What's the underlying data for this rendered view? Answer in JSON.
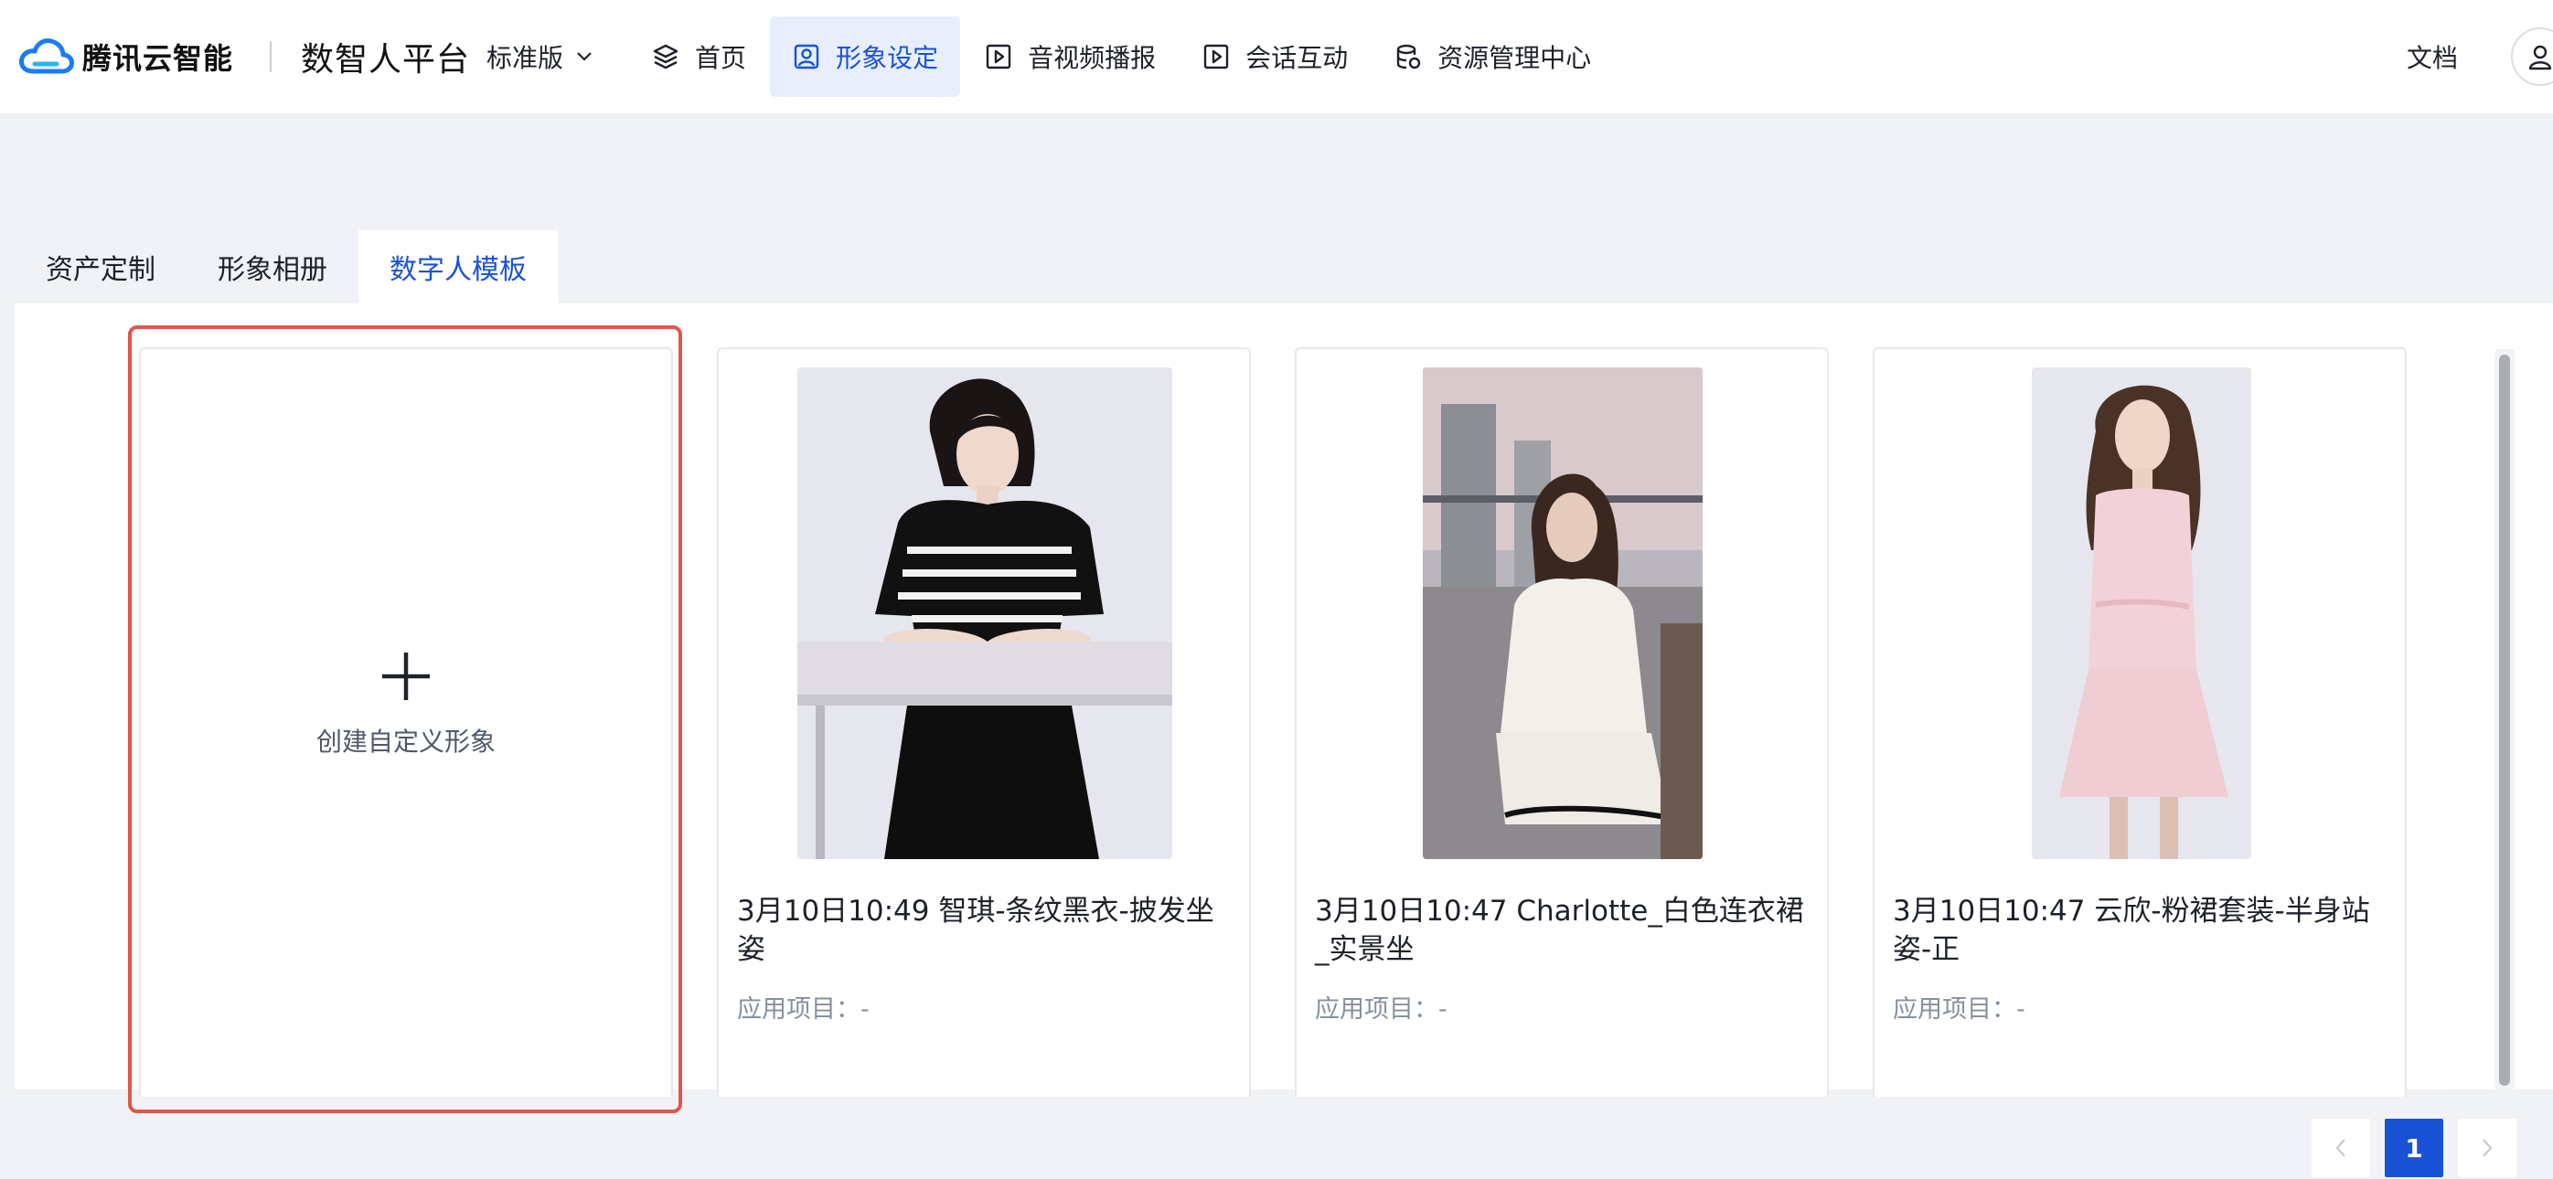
{
  "header": {
    "brand_name": "腾讯云智能",
    "platform_name": "数智人平台",
    "edition": "标准版",
    "nav": [
      {
        "label": "首页",
        "icon": "layers-icon"
      },
      {
        "label": "形象设定",
        "icon": "portrait-icon",
        "active": true
      },
      {
        "label": "音视频播报",
        "icon": "play-icon"
      },
      {
        "label": "会话互动",
        "icon": "play-icon"
      },
      {
        "label": "资源管理中心",
        "icon": "database-icon"
      }
    ],
    "docs_label": "文档"
  },
  "tabs": [
    {
      "label": "资产定制"
    },
    {
      "label": "形象相册"
    },
    {
      "label": "数字人模板",
      "active": true
    }
  ],
  "create_card": {
    "label": "创建自定义形象"
  },
  "templates": [
    {
      "title": "3月10日10:49 智琪-条纹黑衣-披发坐姿",
      "meta": "应用项目：-"
    },
    {
      "title": "3月10日10:47 Charlotte_白色连衣裙_实景坐",
      "meta": "应用项目：-"
    },
    {
      "title": "3月10日10:47 云欣-粉裙套装-半身站姿-正",
      "meta": "应用项目：-"
    }
  ],
  "pagination": {
    "current_page": "1"
  },
  "colors": {
    "accent": "#1a52d6",
    "highlight": "#e0574a",
    "nav_active_bg": "#e8eefc",
    "page_bg": "#f1f2f7"
  }
}
